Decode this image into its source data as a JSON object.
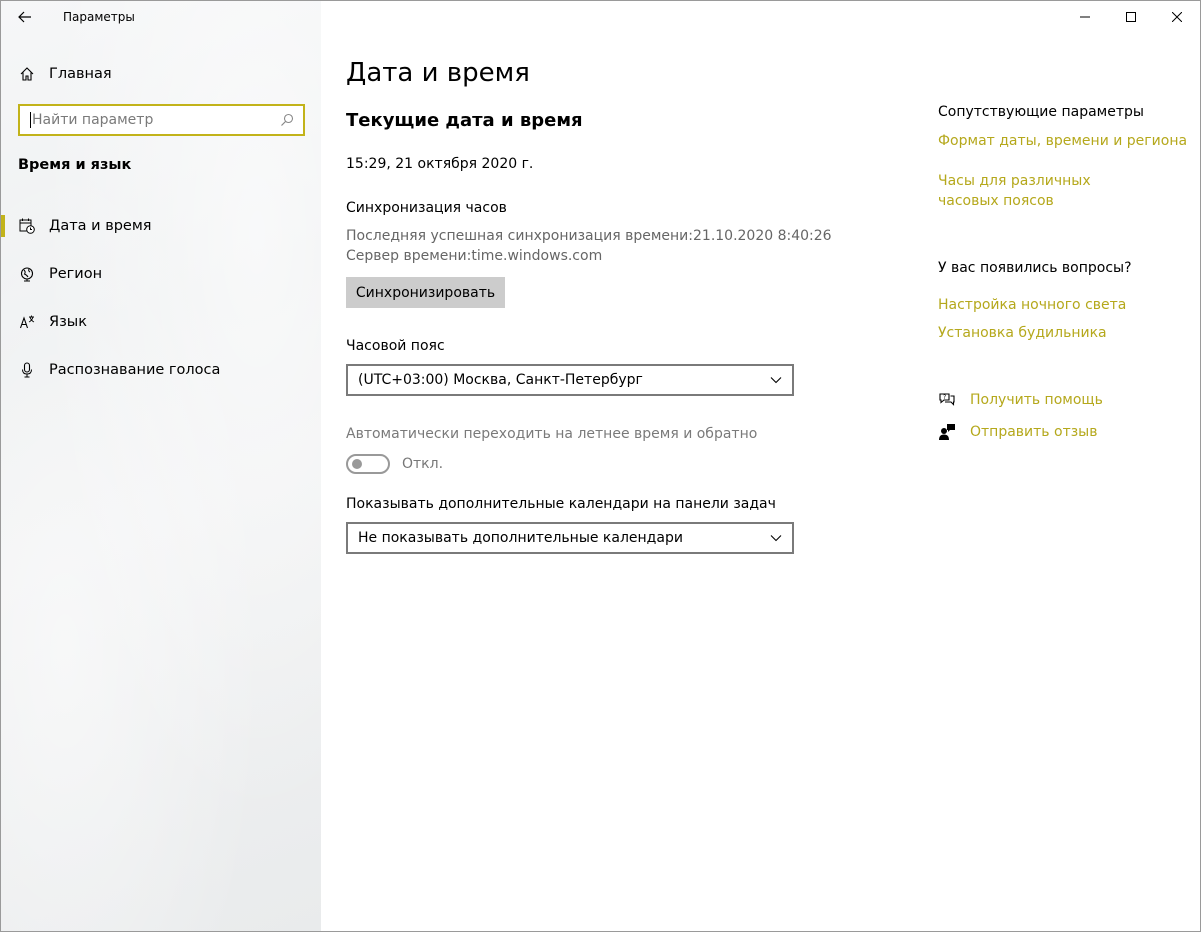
{
  "app": {
    "title": "Параметры"
  },
  "sidebar": {
    "home_label": "Главная",
    "search_placeholder": "Найти параметр",
    "section_title": "Время и язык",
    "items": [
      {
        "label": "Дата и время",
        "icon": "calendar-clock-icon",
        "active": true
      },
      {
        "label": "Регион",
        "icon": "globe-icon"
      },
      {
        "label": "Язык",
        "icon": "language-icon"
      },
      {
        "label": "Распознавание голоса",
        "icon": "microphone-icon"
      }
    ]
  },
  "main": {
    "title": "Дата и время",
    "subtitle": "Текущие дата и время",
    "current_datetime": "15:29, 21 октября 2020 г.",
    "sync": {
      "heading": "Синхронизация часов",
      "last_sync": "Последняя успешная синхронизация времени:21.10.2020 8:40:26",
      "server": "Сервер времени:time.windows.com",
      "button_label": "Синхронизировать"
    },
    "timezone": {
      "label": "Часовой пояс",
      "value": "(UTC+03:00) Москва, Санкт-Петербург"
    },
    "dst": {
      "label": "Автоматически переходить на летнее время и обратно",
      "state": "Откл."
    },
    "calendars": {
      "label": "Показывать дополнительные календари на панели задач",
      "value": "Не показывать дополнительные календари"
    }
  },
  "aside": {
    "related_heading": "Сопутствующие параметры",
    "related_links": [
      "Формат даты, времени и региона",
      "Часы для различных часовых поясов"
    ],
    "questions_heading": "У вас появились вопросы?",
    "question_links": [
      "Настройка ночного света",
      "Установка будильника"
    ],
    "help_label": "Получить помощь",
    "feedback_label": "Отправить отзыв"
  },
  "colors": {
    "accent": "#b5a81c",
    "accent_border": "#c2b31a",
    "button_bg": "#cccccc"
  }
}
